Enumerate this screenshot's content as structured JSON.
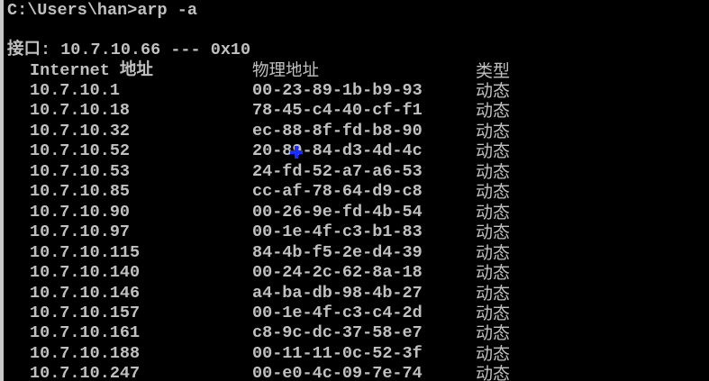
{
  "prompt": "C:\\Users\\han>arp -a",
  "interface_line": "接口: 10.7.10.66 --- 0x10",
  "headers": {
    "ip": "Internet 地址",
    "mac": "物理地址",
    "type": "类型"
  },
  "rows": [
    {
      "ip": "10.7.10.1",
      "mac": "00-23-89-1b-b9-93",
      "type": "动态"
    },
    {
      "ip": "10.7.10.18",
      "mac": "78-45-c4-40-cf-f1",
      "type": "动态"
    },
    {
      "ip": "10.7.10.32",
      "mac": "ec-88-8f-fd-b8-90",
      "type": "动态"
    },
    {
      "ip": "10.7.10.52",
      "mac": "20-89-84-d3-4d-4c",
      "type": "动态"
    },
    {
      "ip": "10.7.10.53",
      "mac": "24-fd-52-a7-a6-53",
      "type": "动态"
    },
    {
      "ip": "10.7.10.85",
      "mac": "cc-af-78-64-d9-c8",
      "type": "动态"
    },
    {
      "ip": "10.7.10.90",
      "mac": "00-26-9e-fd-4b-54",
      "type": "动态"
    },
    {
      "ip": "10.7.10.97",
      "mac": "00-1e-4f-c3-b1-83",
      "type": "动态"
    },
    {
      "ip": "10.7.10.115",
      "mac": "84-4b-f5-2e-d4-39",
      "type": "动态"
    },
    {
      "ip": "10.7.10.140",
      "mac": "00-24-2c-62-8a-18",
      "type": "动态"
    },
    {
      "ip": "10.7.10.146",
      "mac": "a4-ba-db-98-4b-27",
      "type": "动态"
    },
    {
      "ip": "10.7.10.157",
      "mac": "00-1e-4f-c3-c4-2d",
      "type": "动态"
    },
    {
      "ip": "10.7.10.161",
      "mac": "c8-9c-dc-37-58-e7",
      "type": "动态"
    },
    {
      "ip": "10.7.10.188",
      "mac": "00-11-11-0c-52-3f",
      "type": "动态"
    },
    {
      "ip": "10.7.10.247",
      "mac": "00-e0-4c-09-7e-74",
      "type": "动态"
    }
  ]
}
